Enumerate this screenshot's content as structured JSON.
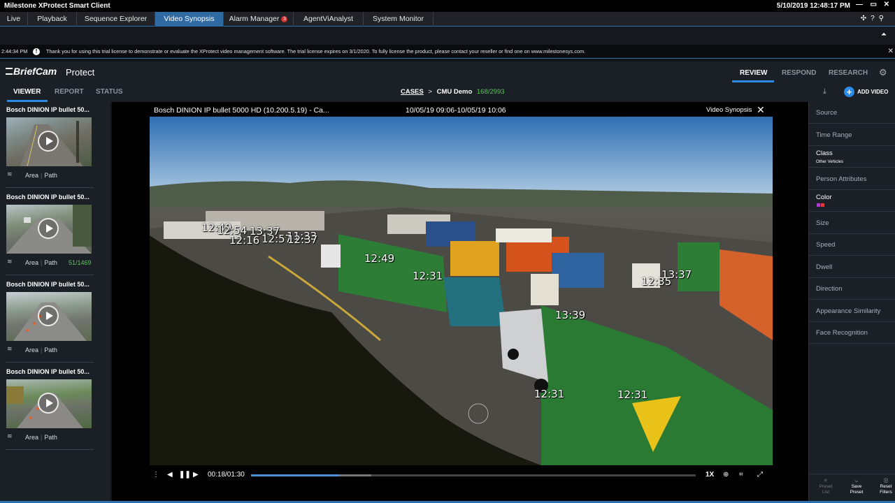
{
  "titlebar": {
    "title": "Milestone XProtect Smart Client",
    "datetime": "5/10/2019 12:48:17 PM"
  },
  "tabs": [
    {
      "label": "Live"
    },
    {
      "label": "Playback"
    },
    {
      "label": "Sequence Explorer"
    },
    {
      "label": "Video Synopsis"
    },
    {
      "label": "Alarm Manager",
      "badge": "3"
    },
    {
      "label": "AgentViAnalyst"
    },
    {
      "label": "System Monitor"
    }
  ],
  "notice": {
    "time": "2:44:34 PM",
    "text": "Thank you for using this trial license to demonstrate or evaluate the XProtect video management software. The trial license expires on 3/1/2020. To fully license the product, please contact your reseller or find one on www.milestonesys.com."
  },
  "briefcam": {
    "logo": "BriefCam",
    "product": "Protect",
    "nav": [
      "REVIEW",
      "RESPOND",
      "RESEARCH"
    ]
  },
  "subnav": {
    "items": [
      "VIEWER",
      "REPORT",
      "STATUS"
    ],
    "breadcrumb_cases": "CASES",
    "breadcrumb_sep": ">",
    "breadcrumb_case": "CMU Demo",
    "breadcrumb_count": "168/2993",
    "add_video": "ADD VIDEO"
  },
  "cards": [
    {
      "title": "Bosch DINION IP bullet 50...",
      "area": "Area",
      "path": "Path",
      "count": ""
    },
    {
      "title": "Bosch DINION IP bullet 50...",
      "area": "Area",
      "path": "Path",
      "count": "51/1469"
    },
    {
      "title": "Bosch DINION IP bullet 50...",
      "area": "Area",
      "path": "Path",
      "count": ""
    },
    {
      "title": "Bosch DINION IP bullet 50...",
      "area": "Area",
      "path": "Path",
      "count": ""
    }
  ],
  "player": {
    "title": "Bosch DINION IP bullet 5000 HD (10.200.5.19) - Ca...",
    "range": "10/05/19 09:06-10/05/19 10:06",
    "mode": "Video Synopsis",
    "time": "00:18/01:30",
    "speed": "1X",
    "progress": 0.2,
    "buffered_to": 0.27
  },
  "timestamps": [
    "12:49",
    "12:54",
    "13:37",
    "11:33",
    "12:16",
    "12:57",
    "12:37",
    "12:49",
    "12:31",
    "13:37",
    "12:35",
    "13:39",
    "12:31",
    "12:31"
  ],
  "filters": [
    {
      "label": "Source"
    },
    {
      "label": "Time Range"
    },
    {
      "label": "Class",
      "sub": "Other Vehicles"
    },
    {
      "label": "Person Attributes"
    },
    {
      "label": "Color",
      "colors": [
        "#b03ad0",
        "#e03a3a"
      ]
    },
    {
      "label": "Size"
    },
    {
      "label": "Speed"
    },
    {
      "label": "Dwell"
    },
    {
      "label": "Direction"
    },
    {
      "label": "Appearance Similarity"
    },
    {
      "label": "Face Recognition"
    }
  ],
  "bottom_buttons": [
    {
      "label": "Preset List"
    },
    {
      "label": "Save Preset"
    },
    {
      "label": "Reset Filters"
    }
  ],
  "colors": {
    "accent": "#2c8be5",
    "count_green": "#5cc35c",
    "active_tab": "#2f6aa3"
  }
}
